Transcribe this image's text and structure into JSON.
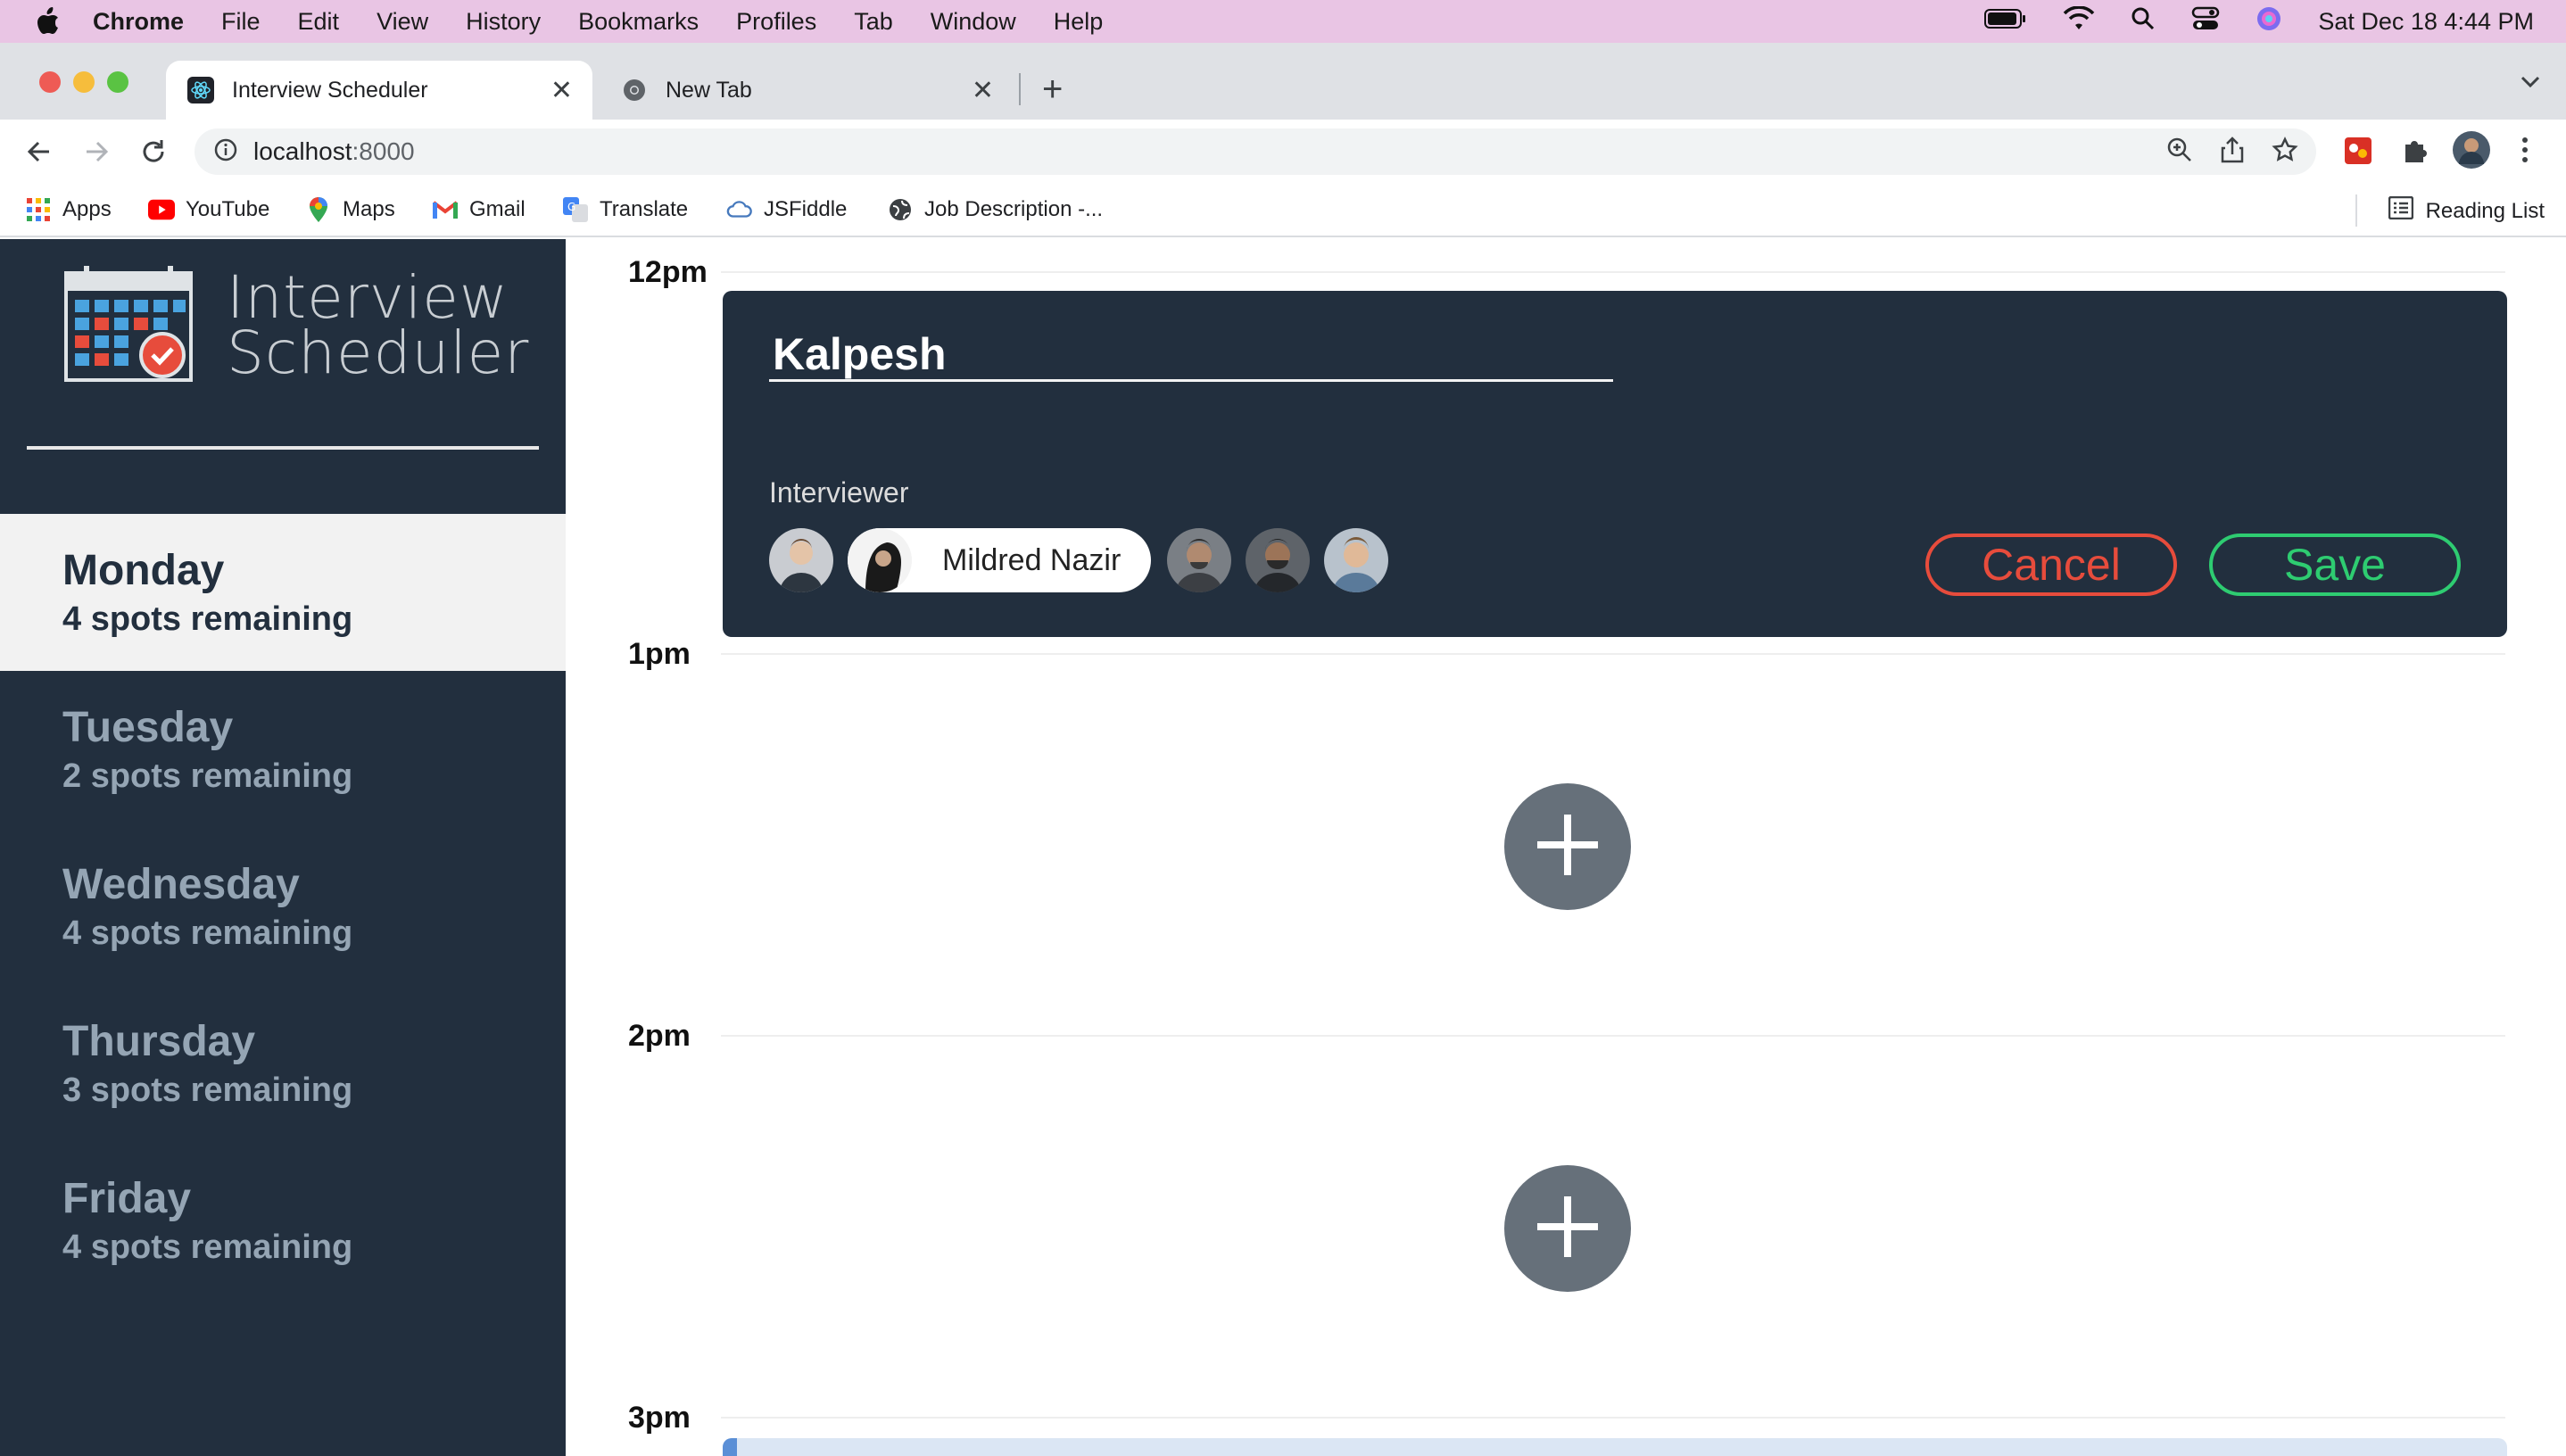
{
  "menubar": {
    "app": "Chrome",
    "items": [
      "File",
      "Edit",
      "View",
      "History",
      "Bookmarks",
      "Profiles",
      "Tab",
      "Window",
      "Help"
    ],
    "clock": "Sat Dec 18  4:44 PM"
  },
  "tabs": [
    {
      "title": "Interview Scheduler",
      "active": true
    },
    {
      "title": "New Tab",
      "active": false
    }
  ],
  "address": {
    "host": "localhost",
    "port": ":8000"
  },
  "bookmarks": [
    "Apps",
    "YouTube",
    "Maps",
    "Gmail",
    "Translate",
    "JSFiddle",
    "Job Description -..."
  ],
  "reading_list": "Reading List",
  "app": {
    "logo_line1": "Interview",
    "logo_line2": "Scheduler",
    "days": [
      {
        "name": "Monday",
        "spots": "4 spots remaining",
        "selected": true
      },
      {
        "name": "Tuesday",
        "spots": "2 spots remaining",
        "selected": false
      },
      {
        "name": "Wednesday",
        "spots": "4 spots remaining",
        "selected": false
      },
      {
        "name": "Thursday",
        "spots": "3 spots remaining",
        "selected": false
      },
      {
        "name": "Friday",
        "spots": "4 spots remaining",
        "selected": false
      }
    ],
    "hours": [
      "12pm",
      "1pm",
      "2pm",
      "3pm"
    ],
    "form": {
      "student_name": "Kalpesh",
      "interviewer_label": "Interviewer",
      "selected_interviewer": "Mildred Nazir",
      "cancel": "Cancel",
      "save": "Save"
    },
    "colors": {
      "sidebar": "#222f3e",
      "cancel": "#e74c3c",
      "save": "#2ecc71",
      "add": "#66707a"
    }
  }
}
